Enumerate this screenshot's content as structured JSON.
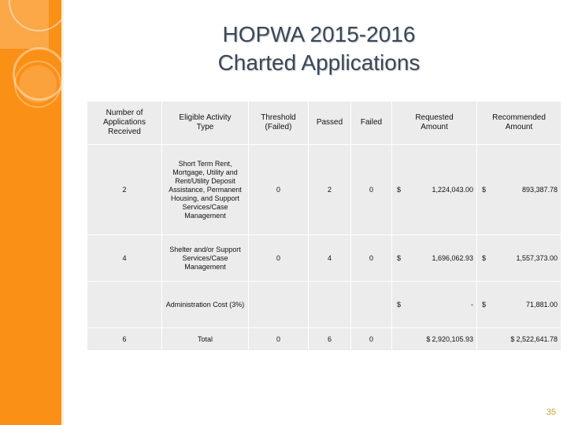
{
  "slide": {
    "title_line1": "HOPWA 2015-2016",
    "title_line2": "Charted Applications",
    "slide_number": "35",
    "accent_color": "#FA9016",
    "title_color": "#3B4856",
    "table_cell_color": "#ECECEC",
    "slide_number_color": "#C9A227"
  },
  "table": {
    "headers": [
      "Number of Applications Received",
      "Eligible Activity Type",
      "Threshold (Failed)",
      "Passed",
      "Failed",
      "Requested Amount",
      "Recommended Amount"
    ],
    "header_lines": {
      "apps": [
        "Number of",
        "Applications",
        "Received"
      ],
      "activity": [
        "Eligible Activity",
        "Type"
      ],
      "threshold": [
        "Threshold",
        "(Failed)"
      ],
      "passed": [
        "Passed"
      ],
      "failed": [
        "Failed"
      ],
      "requested": [
        "Requested",
        "Amount"
      ],
      "recommended": [
        "Recommended",
        "Amount"
      ]
    },
    "rows": [
      {
        "applications": "2",
        "activity": "Short Term Rent, Mortgage, Utility and Rent/Utility Deposit Assistance, Permanent Housing, and Support Services/Case Management",
        "threshold_failed": "0",
        "passed": "2",
        "failed": "0",
        "requested_currency": "$",
        "requested_amount": "1,224,043.00",
        "recommended_currency": "$",
        "recommended_amount": "893,387.78"
      },
      {
        "applications": "4",
        "activity": "Shelter and/or Support Services/Case Management",
        "threshold_failed": "0",
        "passed": "4",
        "failed": "0",
        "requested_currency": "$",
        "requested_amount": "1,696,062.93",
        "recommended_currency": "$",
        "recommended_amount": "1,557,373.00"
      },
      {
        "applications": "",
        "activity": "Administration Cost (3%)",
        "threshold_failed": "",
        "passed": "",
        "failed": "",
        "requested_currency": "$",
        "requested_amount": "-",
        "recommended_currency": "$",
        "recommended_amount": "71,881.00"
      },
      {
        "applications": "6",
        "activity": "Total",
        "threshold_failed": "0",
        "passed": "6",
        "failed": "0",
        "requested_currency": "$",
        "requested_amount": "2,920,105.93",
        "recommended_currency": "$",
        "recommended_amount": "2,522,641.78"
      }
    ]
  }
}
